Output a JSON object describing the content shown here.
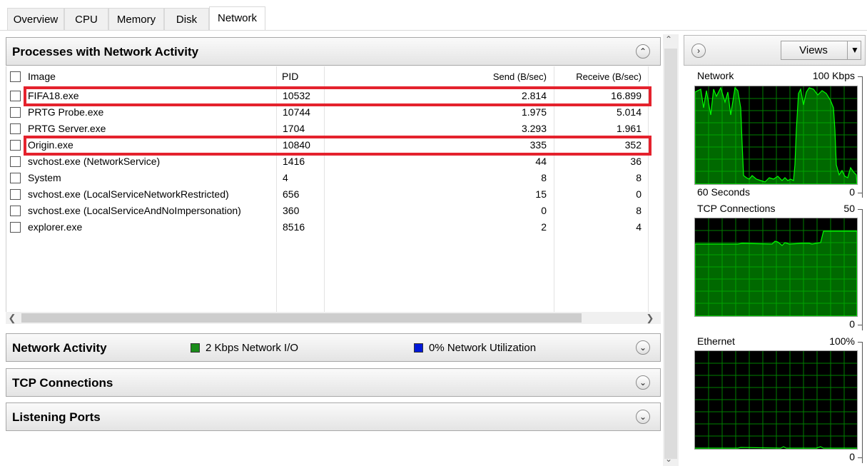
{
  "tabs": [
    "Overview",
    "CPU",
    "Memory",
    "Disk",
    "Network"
  ],
  "processes": {
    "title": "Processes with Network Activity",
    "columns": {
      "image": "Image",
      "pid": "PID",
      "send": "Send (B/sec)",
      "receive": "Receive (B/sec)"
    },
    "rows": [
      {
        "image": "FIFA18.exe",
        "pid": "10532",
        "send": "2.814",
        "receive": "16.899"
      },
      {
        "image": "PRTG Probe.exe",
        "pid": "10744",
        "send": "1.975",
        "receive": "5.014"
      },
      {
        "image": "PRTG Server.exe",
        "pid": "1704",
        "send": "3.293",
        "receive": "1.961"
      },
      {
        "image": "Origin.exe",
        "pid": "10840",
        "send": "335",
        "receive": "352"
      },
      {
        "image": "svchost.exe (NetworkService)",
        "pid": "1416",
        "send": "44",
        "receive": "36"
      },
      {
        "image": "System",
        "pid": "4",
        "send": "8",
        "receive": "8"
      },
      {
        "image": "svchost.exe (LocalServiceNetworkRestricted)",
        "pid": "656",
        "send": "15",
        "receive": "0"
      },
      {
        "image": "svchost.exe (LocalServiceAndNoImpersonation)",
        "pid": "360",
        "send": "0",
        "receive": "8"
      },
      {
        "image": "explorer.exe",
        "pid": "8516",
        "send": "2",
        "receive": "4"
      }
    ]
  },
  "network_activity": {
    "title": "Network Activity",
    "io": "2 Kbps Network I/O",
    "util": "0% Network Utilization",
    "io_color": "#1a8c1a",
    "util_color": "#0018d8"
  },
  "tcp_connections": {
    "title": "TCP Connections"
  },
  "listening_ports": {
    "title": "Listening Ports"
  },
  "right_panel": {
    "views": "Views",
    "network": {
      "label": "Network",
      "max": "100 Kbps",
      "footer": "60 Seconds",
      "min": "0"
    },
    "tcp": {
      "label": "TCP Connections",
      "max": "50",
      "min": "0"
    },
    "ethernet": {
      "label": "Ethernet",
      "max": "100%",
      "min": "0"
    }
  },
  "colors": {
    "highlight": "#e4222d",
    "graph_line": "#00ff00",
    "graph_grid": "#008000"
  }
}
